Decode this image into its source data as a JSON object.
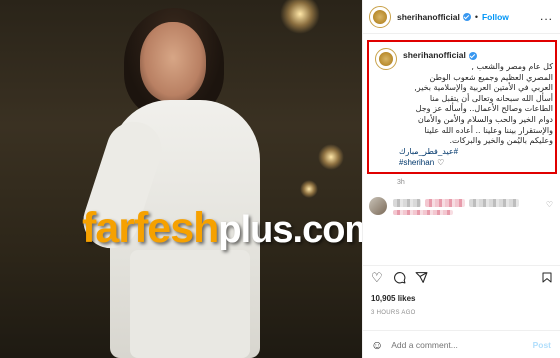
{
  "photo": {
    "alt_icon": "photo-of-singer",
    "watermark": {
      "part1": "farfesh",
      "part2": "plus.com"
    }
  },
  "header": {
    "username": "sherihanofficial",
    "separator": "•",
    "follow_label": "Follow",
    "more_label": "..."
  },
  "caption": {
    "username": "sherihanofficial",
    "lines": [
      "كل عام ومصر والشعب ,",
      "المصري العظيم وجميع شعوب الوطن",
      "العربي في الأمتين العربية والإسلامية بخير,",
      "أسأل الله سبحانه وتعالى أن يتقبل منا",
      "الطاعات وصالح الأعمال.. وأسأله عز وجل",
      "دوام الخير والحب والسلام والأمن والأمان",
      "والإستقرار بيننا وعلينا .. أعاده الله علينا",
      "وعليكم باليُمن والخير والبركات."
    ],
    "hashtag1": "#عيد_فطر_مبارك",
    "hashtag2": "#sherihan",
    "time": "3h"
  },
  "comment": {
    "time": "3h"
  },
  "actions": {
    "like_icon": "heart-icon",
    "comment_icon": "comment-icon",
    "share_icon": "share-icon",
    "save_icon": "bookmark-icon"
  },
  "likes": "10,905 likes",
  "ago": "3 HOURS AGO",
  "add_comment": {
    "placeholder": "Add a comment...",
    "post_label": "Post"
  },
  "colors": {
    "accent": "#0095f6",
    "highlight_border": "#e00000",
    "hashtag": "#00376b",
    "watermark_orange": "#f6a100"
  }
}
